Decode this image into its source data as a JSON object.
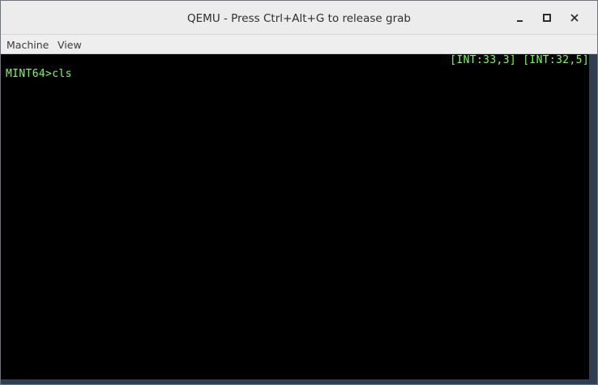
{
  "window": {
    "title": "QEMU - Press Ctrl+Alt+G to release grab",
    "controls": {
      "minimize_icon": "minimize-icon",
      "maximize_icon": "maximize-icon",
      "close_icon": "close-icon"
    }
  },
  "menubar": {
    "items": [
      {
        "label": "Machine"
      },
      {
        "label": "View"
      }
    ]
  },
  "terminal": {
    "status_line": "[INT:33,3] [INT:32,5]",
    "prompt_line": "MINT64>cls",
    "text_color": "#7cfc5c",
    "background": "#000000"
  }
}
